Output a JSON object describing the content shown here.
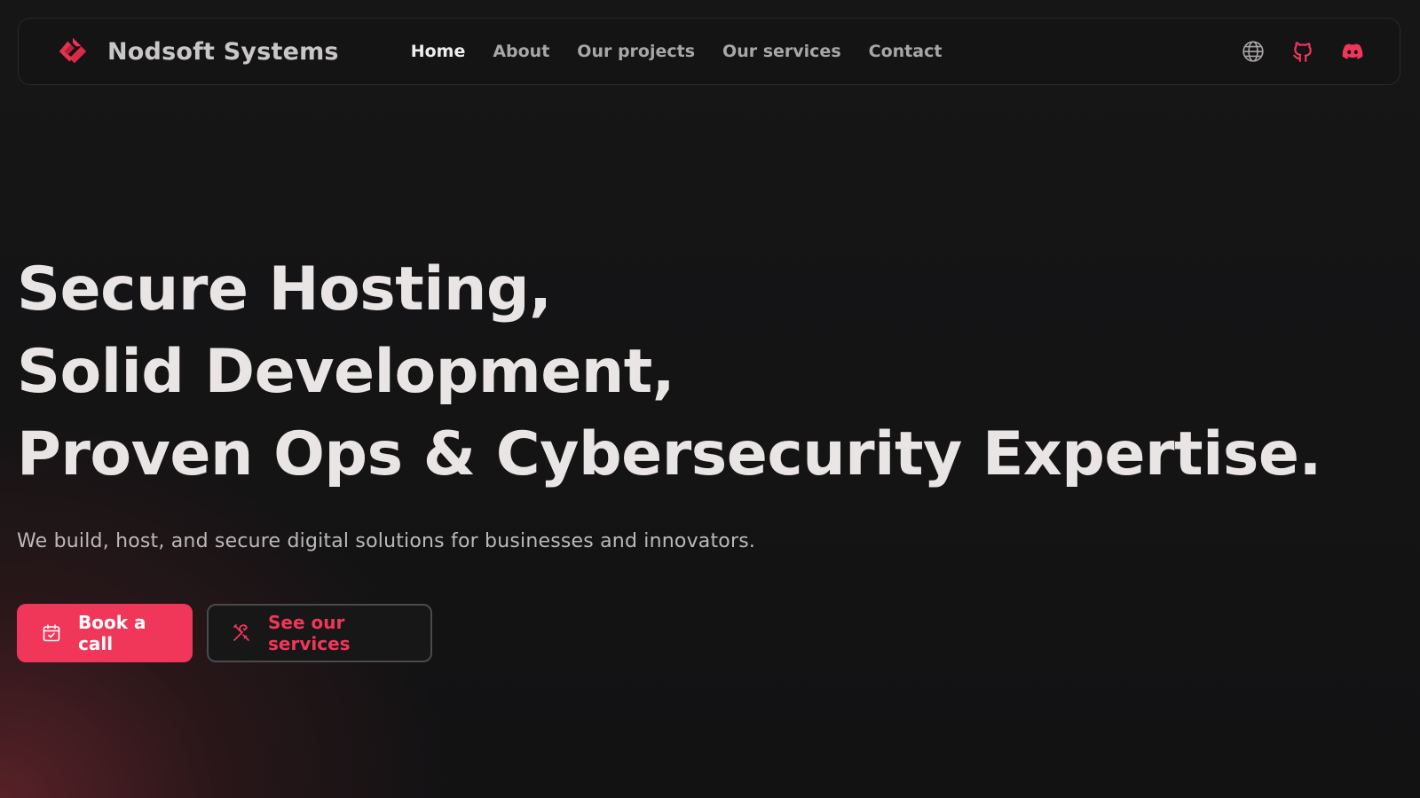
{
  "brand": {
    "name": "Nodsoft Systems",
    "logo_icon": "nodsoft-logo-icon",
    "accent_color": "#f0375a"
  },
  "nav": {
    "links": [
      {
        "label": "Home",
        "active": true
      },
      {
        "label": "About",
        "active": false
      },
      {
        "label": "Our projects",
        "active": false
      },
      {
        "label": "Our services",
        "active": false
      },
      {
        "label": "Contact",
        "active": false
      }
    ],
    "icons": [
      "globe-icon",
      "github-icon",
      "discord-icon"
    ]
  },
  "hero": {
    "title_lines": [
      "Secure Hosting,",
      "Solid Development,",
      "Proven Ops & Cybersecurity Expertise."
    ],
    "subtitle": "We build, host, and secure digital solutions for businesses and innovators.",
    "primary_button": {
      "label": "Book a call",
      "icon": "calendar-check-icon"
    },
    "secondary_button": {
      "label": "See our services",
      "icon": "tools-icon"
    }
  }
}
